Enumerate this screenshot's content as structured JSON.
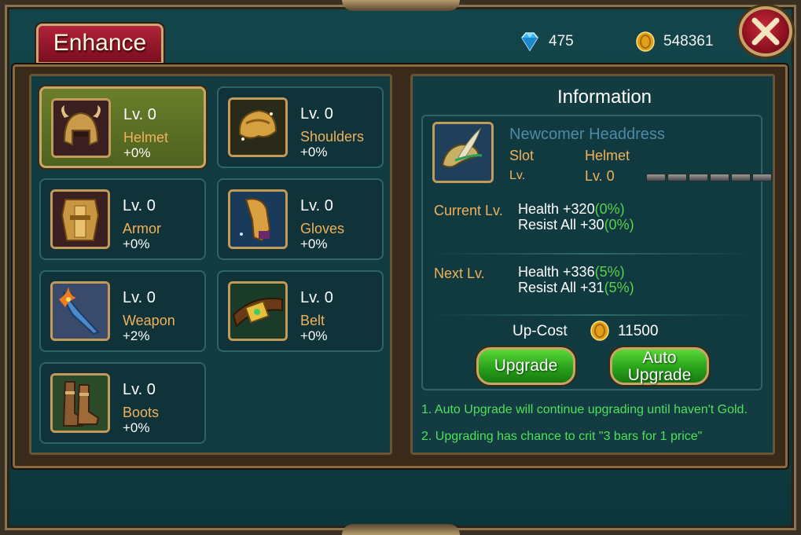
{
  "window": {
    "title": "Enhance"
  },
  "currency": {
    "gems": "475",
    "gold": "548361"
  },
  "slots": [
    {
      "level": "Lv. 0",
      "name": "Helmet",
      "bonus": "+0%",
      "selected": true,
      "icon": "helmet-icon"
    },
    {
      "level": "Lv. 0",
      "name": "Shoulders",
      "bonus": "+0%",
      "icon": "shoulders-icon"
    },
    {
      "level": "Lv. 0",
      "name": "Armor",
      "bonus": "+0%",
      "icon": "armor-icon"
    },
    {
      "level": "Lv. 0",
      "name": "Gloves",
      "bonus": "+0%",
      "icon": "gloves-icon"
    },
    {
      "level": "Lv. 0",
      "name": "Weapon",
      "bonus": "+2%",
      "icon": "weapon-icon"
    },
    {
      "level": "Lv. 0",
      "name": "Belt",
      "bonus": "+0%",
      "icon": "belt-icon"
    },
    {
      "level": "Lv. 0",
      "name": "Boots",
      "bonus": "+0%",
      "icon": "boots-icon"
    }
  ],
  "info": {
    "title": "Information",
    "item_name": "Newcomer Headdress",
    "slot_label": "Slot",
    "slot_value": "Helmet",
    "lv_label": "Lv.",
    "lv_value": "Lv. 0",
    "progress_bars_total": 6,
    "progress_bars_filled": 0,
    "current_label": "Current Lv.",
    "current_health": "Health  +320",
    "current_health_pct": "(0%)",
    "current_resist": "Resist All  +30",
    "current_resist_pct": "(0%)",
    "next_label": "Next Lv.",
    "next_health": "Health  +336",
    "next_health_pct": "(5%)",
    "next_resist": "Resist All  +31",
    "next_resist_pct": "(5%)",
    "upcost_label": "Up-Cost",
    "upcost_value": "11500"
  },
  "buttons": {
    "upgrade": "Upgrade",
    "auto_line1": "Auto",
    "auto_line2": "Upgrade"
  },
  "notes": [
    "1. Auto Upgrade will continue upgrading until haven't Gold.",
    "2. Upgrading has chance to crit \"3 bars for 1 price\""
  ]
}
